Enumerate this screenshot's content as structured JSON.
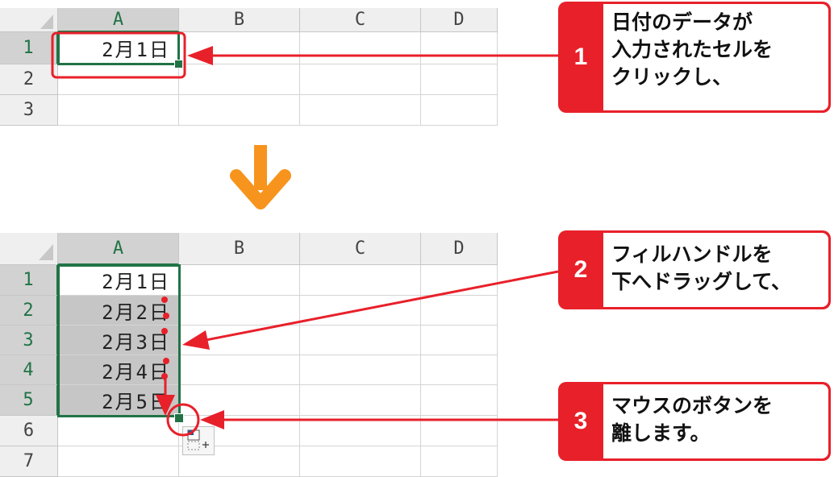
{
  "columns": [
    "A",
    "B",
    "C",
    "D"
  ],
  "top_grid": {
    "rows": [
      "1",
      "2",
      "3"
    ],
    "cells": [
      "2月1日",
      "",
      ""
    ]
  },
  "bottom_grid": {
    "rows": [
      "1",
      "2",
      "3",
      "4",
      "5",
      "6",
      "7"
    ],
    "cells": [
      "2月1日",
      "2月2日",
      "2月3日",
      "2月4日",
      "2月5日",
      "",
      ""
    ]
  },
  "callouts": [
    {
      "num": "1",
      "text": "日付のデータが\n入力されたセルを\nクリックし、"
    },
    {
      "num": "2",
      "text": "フィルハンドルを\n下へドラッグして、"
    },
    {
      "num": "3",
      "text": "マウスのボタンを\n離します。"
    }
  ],
  "colors": {
    "accent_red": "#e8202a",
    "excel_green": "#217346",
    "arrow_orange": "#f7941d",
    "fill_gray": "#c6c6c6"
  },
  "icons": [
    "down-arrow-icon",
    "autofill-options-icon",
    "fill-handle-icon"
  ]
}
